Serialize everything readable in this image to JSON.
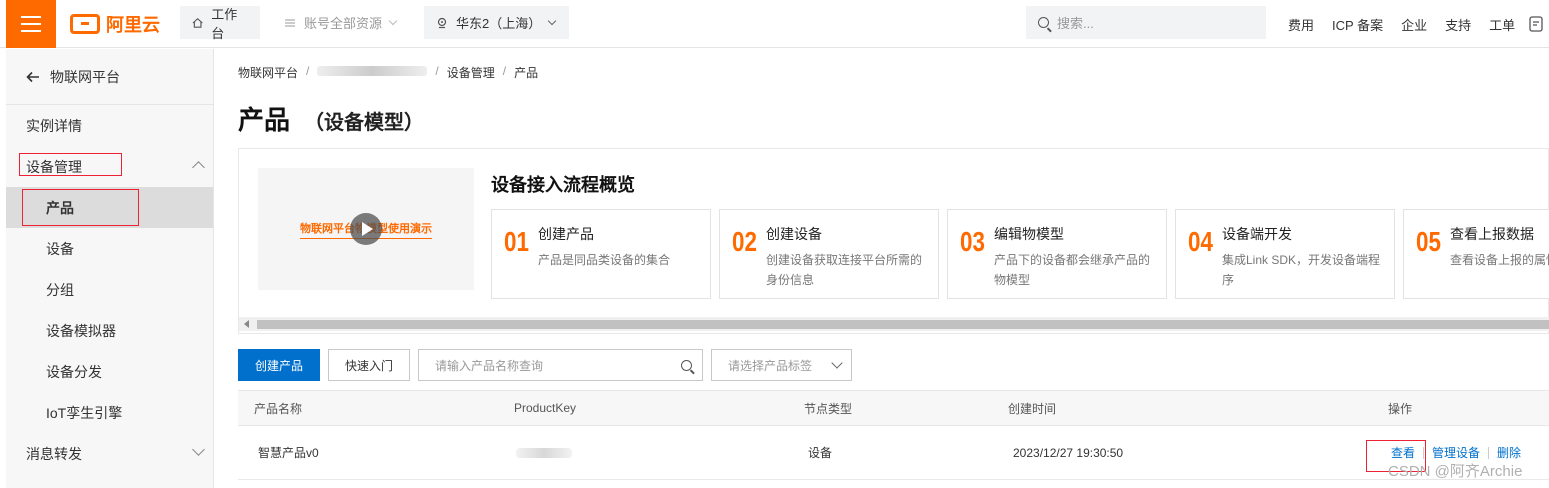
{
  "topbar": {
    "logo_text": "阿里云",
    "workbench": "工作台",
    "resources": "账号全部资源",
    "region": "华东2（上海）",
    "search_placeholder": "搜索...",
    "links": [
      "费用",
      "ICP 备案",
      "企业",
      "支持",
      "工单"
    ]
  },
  "sidebar": {
    "back_label": "物联网平台",
    "items": [
      {
        "label": "实例详情"
      },
      {
        "label": "设备管理"
      },
      {
        "label": "产品"
      },
      {
        "label": "设备"
      },
      {
        "label": "分组"
      },
      {
        "label": "设备模拟器"
      },
      {
        "label": "设备分发"
      },
      {
        "label": "IoT孪生引擎"
      },
      {
        "label": "消息转发"
      }
    ]
  },
  "breadcrumb": {
    "root": "物联网平台",
    "section": "设备管理",
    "current": "产品"
  },
  "page": {
    "title": "产品",
    "subtitle": "（设备模型）"
  },
  "flow": {
    "video_text": "物联网平台物模型使用演示",
    "title": "设备接入流程概览",
    "steps": [
      {
        "num": "01",
        "title": "创建产品",
        "desc": "产品是同品类设备的集合"
      },
      {
        "num": "02",
        "title": "创建设备",
        "desc": "创建设备获取连接平台所需的身份信息"
      },
      {
        "num": "03",
        "title": "编辑物模型",
        "desc": "产品下的设备都会继承产品的物模型"
      },
      {
        "num": "04",
        "title": "设备端开发",
        "desc": "集成Link SDK，开发设备端程序"
      },
      {
        "num": "05",
        "title": "查看上报数据",
        "desc": "查看设备上报的属性"
      }
    ]
  },
  "toolbar": {
    "create_label": "创建产品",
    "quickstart_label": "快速入门",
    "search_placeholder": "请输入产品名称查询",
    "tag_placeholder": "请选择产品标签"
  },
  "table": {
    "headers": [
      "产品名称",
      "ProductKey",
      "节点类型",
      "创建时间",
      "操作"
    ],
    "rows": [
      {
        "name": "智慧产品v0",
        "node_type": "设备",
        "created": "2023/12/27 19:30:50"
      }
    ],
    "actions": [
      "查看",
      "管理设备",
      "删除"
    ]
  },
  "watermark": "CSDN @阿齐Archie",
  "colors": {
    "brand": "#ff6a00",
    "primary": "#0070cc",
    "highlight": "#e22233"
  }
}
